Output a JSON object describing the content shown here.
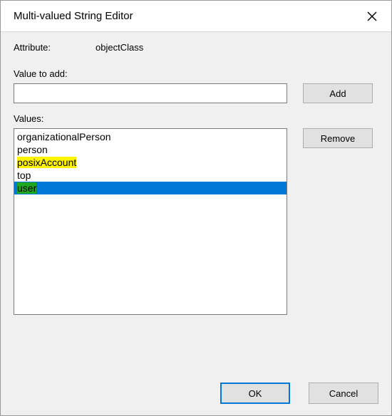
{
  "titlebar": {
    "title": "Multi-valued String Editor"
  },
  "attribute": {
    "label": "Attribute:",
    "value": "objectClass"
  },
  "value_to_add": {
    "label": "Value to add:",
    "input_value": "",
    "placeholder": ""
  },
  "buttons": {
    "add": "Add",
    "remove": "Remove",
    "ok": "OK",
    "cancel": "Cancel"
  },
  "values": {
    "label": "Values:",
    "items": [
      {
        "text": "organizationalPerson",
        "highlight": "none",
        "selected": false
      },
      {
        "text": "person",
        "highlight": "none",
        "selected": false
      },
      {
        "text": "posixAccount",
        "highlight": "yellow",
        "selected": false
      },
      {
        "text": "top",
        "highlight": "none",
        "selected": false
      },
      {
        "text": "user",
        "highlight": "green",
        "selected": true
      }
    ]
  },
  "icons": {
    "close": "close-icon"
  }
}
